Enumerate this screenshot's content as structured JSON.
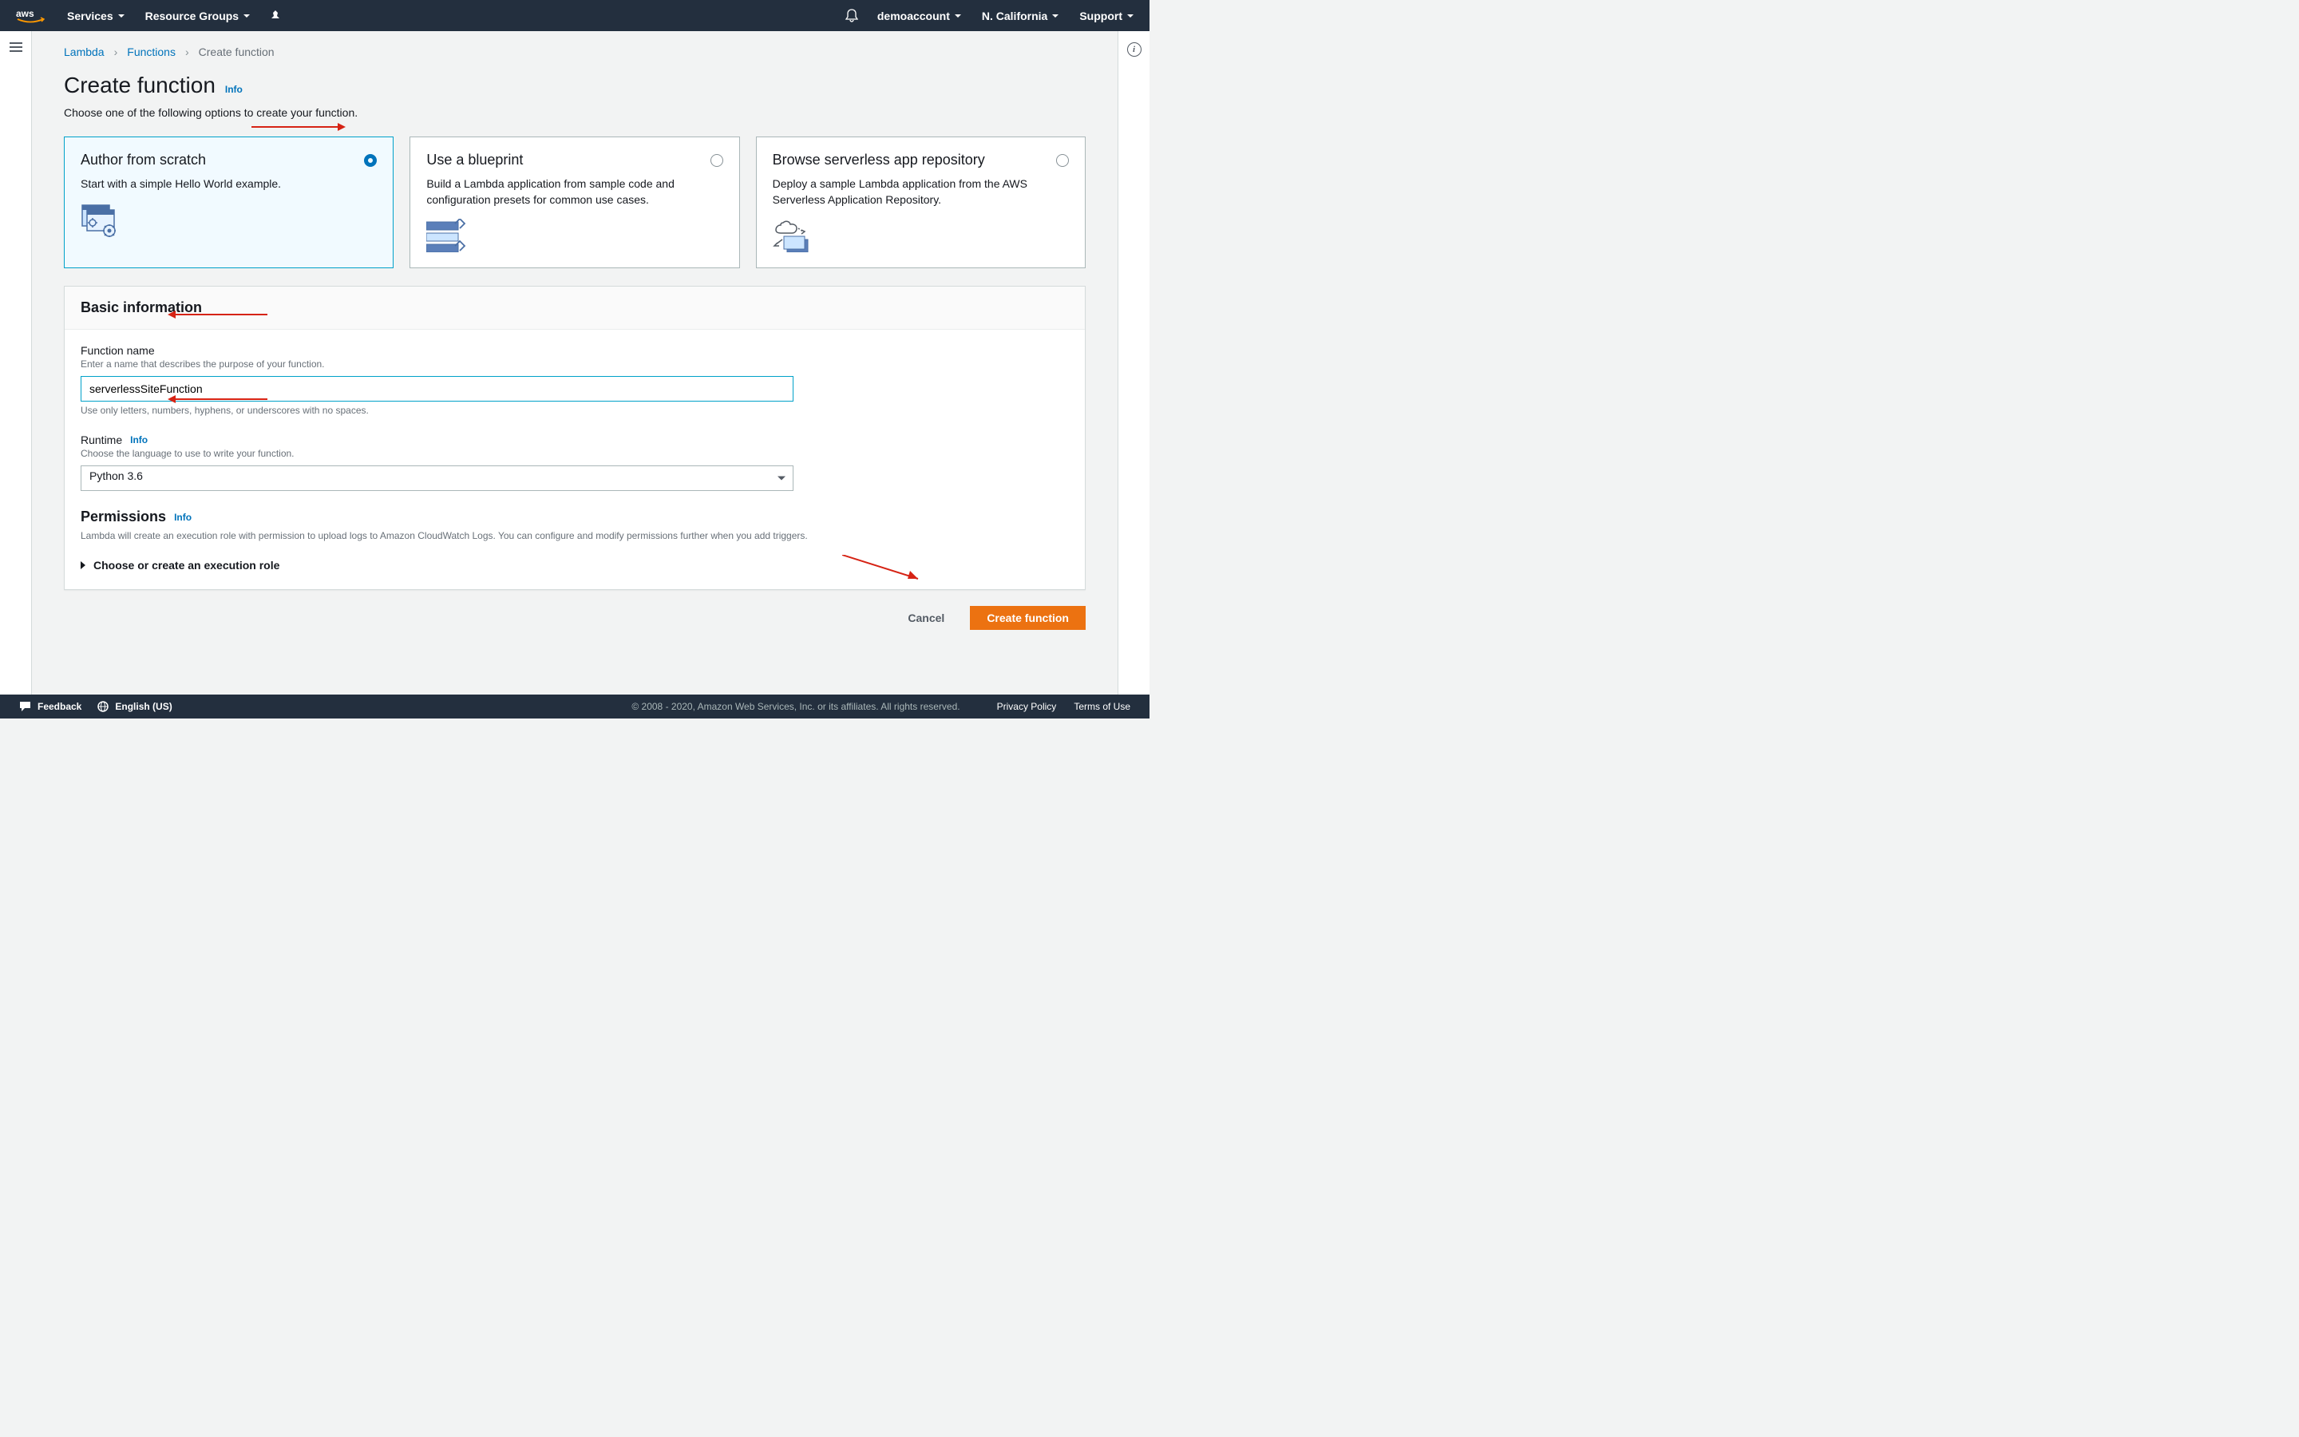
{
  "nav": {
    "services": "Services",
    "resource_groups": "Resource Groups",
    "account": "demoaccount",
    "region": "N. California",
    "support": "Support"
  },
  "breadcrumbs": {
    "lambda": "Lambda",
    "functions": "Functions",
    "current": "Create function"
  },
  "page": {
    "title": "Create function",
    "info": "Info",
    "subtitle": "Choose one of the following options to create your function."
  },
  "cards": [
    {
      "title": "Author from scratch",
      "desc": "Start with a simple Hello World example.",
      "selected": true
    },
    {
      "title": "Use a blueprint",
      "desc": "Build a Lambda application from sample code and configuration presets for common use cases.",
      "selected": false
    },
    {
      "title": "Browse serverless app repository",
      "desc": "Deploy a sample Lambda application from the AWS Serverless Application Repository.",
      "selected": false
    }
  ],
  "basic": {
    "header": "Basic information",
    "fn_label": "Function name",
    "fn_hint": "Enter a name that describes the purpose of your function.",
    "fn_value": "serverlessSiteFunction",
    "fn_help": "Use only letters, numbers, hyphens, or underscores with no spaces.",
    "rt_label": "Runtime",
    "rt_info": "Info",
    "rt_hint": "Choose the language to use to write your function.",
    "rt_value": "Python 3.6",
    "perm_title": "Permissions",
    "perm_info": "Info",
    "perm_desc": "Lambda will create an execution role with permission to upload logs to Amazon CloudWatch Logs. You can configure and modify permissions further when you add triggers.",
    "expander": "Choose or create an execution role"
  },
  "actions": {
    "cancel": "Cancel",
    "create": "Create function"
  },
  "footer": {
    "feedback": "Feedback",
    "language": "English (US)",
    "copyright": "© 2008 - 2020, Amazon Web Services, Inc. or its affiliates. All rights reserved.",
    "privacy": "Privacy Policy",
    "terms": "Terms of Use"
  }
}
